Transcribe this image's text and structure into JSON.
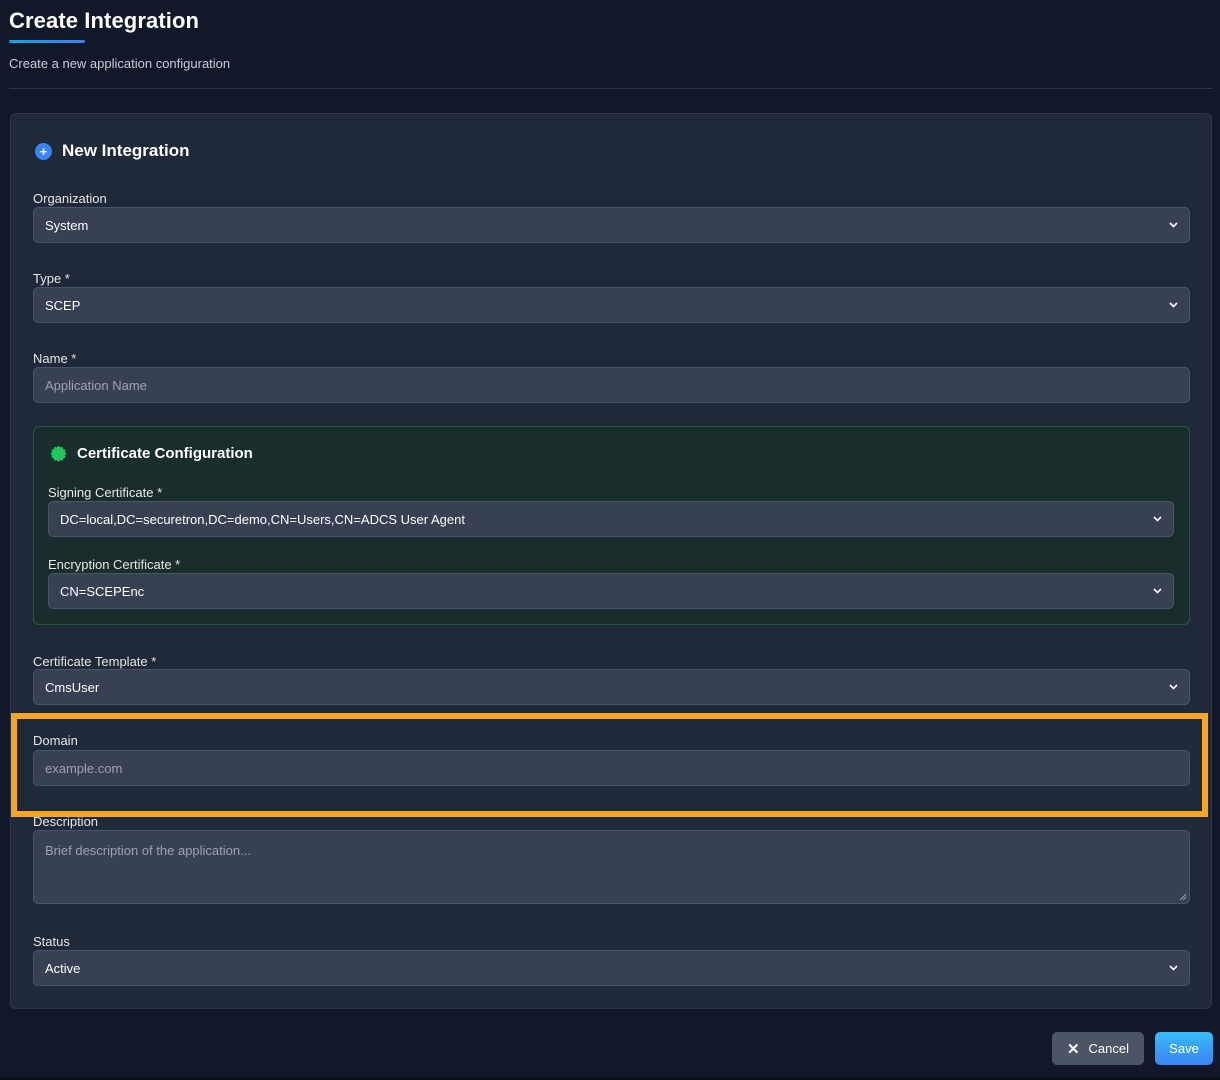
{
  "header": {
    "title": "Create Integration",
    "subtitle": "Create a new application configuration"
  },
  "card": {
    "title": "New Integration",
    "icon": "plus-circle-icon"
  },
  "fields": {
    "organization": {
      "label": "Organization",
      "value": "System"
    },
    "type": {
      "label": "Type *",
      "value": "SCEP"
    },
    "name": {
      "label": "Name *",
      "placeholder": "Application Name"
    },
    "certificate_template": {
      "label": "Certificate Template *",
      "value": "CmsUser"
    },
    "domain": {
      "label": "Domain",
      "placeholder": "example.com"
    },
    "description": {
      "label": "Description",
      "placeholder": "Brief description of the application..."
    },
    "status": {
      "label": "Status",
      "value": "Active"
    }
  },
  "cert_config": {
    "title": "Certificate Configuration",
    "icon": "certificate-badge-icon",
    "signing": {
      "label": "Signing Certificate *",
      "value": "DC=local,DC=securetron,DC=demo,CN=Users,CN=ADCS User Agent"
    },
    "encryption": {
      "label": "Encryption Certificate *",
      "value": "CN=SCEPEnc"
    }
  },
  "actions": {
    "cancel_label": "Cancel",
    "save_label": "Save"
  },
  "colors": {
    "background": "#111827",
    "card": "#1f2937",
    "input": "#374151",
    "accent": "#3b82f6",
    "cert_green": "#22c55e",
    "highlight": "#f6a623"
  }
}
